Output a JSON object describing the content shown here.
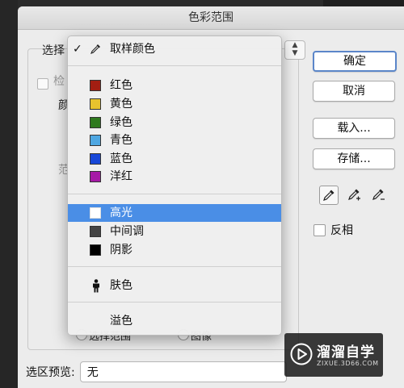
{
  "window": {
    "title": "色彩范围"
  },
  "behind": {
    "select_label": "选择",
    "detect_label": "检",
    "color_label": "颜",
    "range_label": "范",
    "radio_selection": "选择范围",
    "radio_image": "图像"
  },
  "menu": {
    "sampled_colors": "取样颜色",
    "colors": [
      {
        "label": "红色",
        "color": "#a31e12"
      },
      {
        "label": "黄色",
        "color": "#e8c32e"
      },
      {
        "label": "绿色",
        "color": "#2f7a1e"
      },
      {
        "label": "青色",
        "color": "#4ea7e2"
      },
      {
        "label": "蓝色",
        "color": "#1747d8"
      },
      {
        "label": "洋红",
        "color": "#a61aa6"
      }
    ],
    "tones": [
      {
        "label": "高光",
        "color": "#ffffff"
      },
      {
        "label": "中间调",
        "color": "#444444"
      },
      {
        "label": "阴影",
        "color": "#000000"
      }
    ],
    "skin_tones": "肤色",
    "out_of_gamut": "溢色"
  },
  "buttons": {
    "ok": "确定",
    "cancel": "取消",
    "load": "载入...",
    "save": "存储..."
  },
  "invert_label": "反相",
  "preview": {
    "label": "选区预览:",
    "value": "无"
  },
  "watermark": {
    "title": "溜溜自学",
    "subtitle": "ZIXUE.3D66.COM"
  }
}
